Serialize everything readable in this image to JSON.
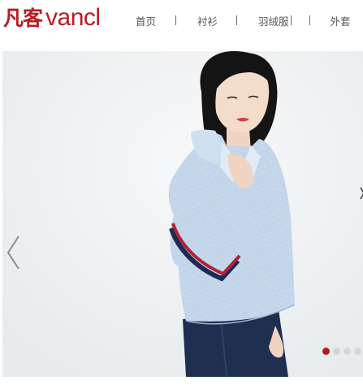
{
  "brand": {
    "logo_cn": "凡客",
    "logo_en": "vancl",
    "color": "#b81c22"
  },
  "nav": {
    "items": [
      {
        "label": "首页"
      },
      {
        "label": "衬衫"
      },
      {
        "label": "羽绒服"
      },
      {
        "label": "外套"
      }
    ],
    "text_color": "#555555"
  },
  "carousel": {
    "prev_icon": "chevron-left-icon",
    "next_icon": "chevron-right-icon",
    "slide_count": 4,
    "active_slide": 1,
    "active_dot_color": "#b51a1a",
    "inactive_dot_color": "#d6d6d6"
  }
}
